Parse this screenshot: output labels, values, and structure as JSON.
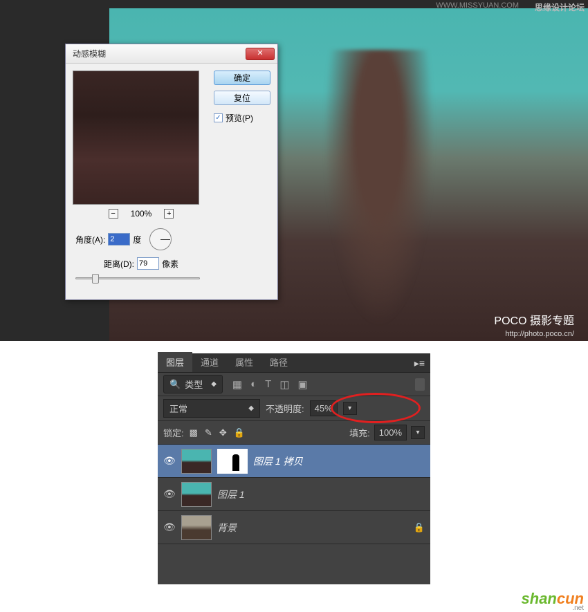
{
  "top_watermark": {
    "text": "思缘设计论坛",
    "url": "WWW.MISSYUAN.COM"
  },
  "poco": {
    "logo1": "POCO",
    "logo2": " 摄影专题",
    "url": "http://photo.poco.cn/"
  },
  "dialog": {
    "title": "动感模糊",
    "ok": "确定",
    "reset": "复位",
    "preview_label": "预览(P)",
    "preview_checked": "✓",
    "zoom": "100%",
    "angle_label": "角度(A):",
    "angle_value": "2",
    "angle_unit": "度",
    "distance_label": "距离(D):",
    "distance_value": "79",
    "distance_unit": "像素"
  },
  "layers_panel": {
    "tabs": [
      "图层",
      "通道",
      "属性",
      "路径"
    ],
    "filter_label": "类型",
    "blend_mode": "正常",
    "opacity_label": "不透明度:",
    "opacity_value": "45%",
    "lock_label": "锁定:",
    "fill_label": "填充:",
    "fill_value": "100%",
    "layers": [
      {
        "name": "图层 1 拷贝"
      },
      {
        "name": "图层 1"
      },
      {
        "name": "背景"
      }
    ]
  },
  "shancun": {
    "t1": "shan",
    "t2": "cun",
    "net": ".net"
  }
}
